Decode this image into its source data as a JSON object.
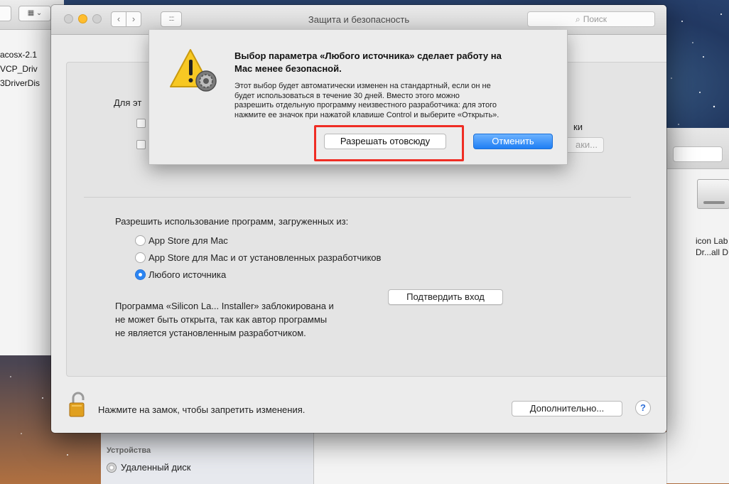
{
  "window": {
    "title": "Защита и безопасность",
    "search_placeholder": "Поиск",
    "grid_glyph": "::::",
    "back_glyph": "‹",
    "forward_glyph": "›"
  },
  "background_finder": {
    "view_button_glyph": "▦ ⌄",
    "files": [
      "acosx-2.1",
      "VCP_Driv",
      "3DriverDis"
    ],
    "right_labels": [
      "icon Lab",
      "Dr...all D"
    ],
    "sidebar_heading": "Устройства",
    "sidebar_item": "Удаленный диск"
  },
  "panel": {
    "partial_label": "Для эт",
    "partial_right_text": "ки",
    "partial_right_button": "аки...",
    "allow_heading": "Разрешить использование программ, загруженных из:",
    "radio_options": [
      {
        "label": "App Store для Mac",
        "selected": false
      },
      {
        "label": "App Store для Mac и от установленных разработчиков",
        "selected": false
      },
      {
        "label": "Любого источника",
        "selected": true
      }
    ],
    "blocked_lines": [
      "Программа «Silicon La... Installer» заблокирована и",
      "не может быть открыта, так как автор программы",
      "не является установленным разработчиком."
    ],
    "confirm_button": "Подтвердить вход"
  },
  "footer": {
    "lock_text": "Нажмите на замок, чтобы запретить изменения.",
    "advanced_button": "Дополнительно...",
    "help_button": "?"
  },
  "alert": {
    "title_lines": [
      "Выбор параметра «Любого источника» сделает работу на",
      "Mac менее безопасной."
    ],
    "body_lines": [
      "Этот выбор будет автоматически изменен на стандартный, если он не",
      "будет использоваться в течение 30 дней. Вместо этого можно",
      "разрешить отдельную программу неизвестного разработчика: для этого",
      "нажмите ее значок при нажатой клавише Control и выберите «Открыть»."
    ],
    "allow_button": "Разрешать отовсюду",
    "cancel_button": "Отменить"
  },
  "colors": {
    "accent": "#1f7ef4",
    "highlight_box": "#ef2d24",
    "warning_yellow": "#f7c823"
  },
  "icons": [
    "close-icon",
    "minimize-icon",
    "zoom-icon",
    "back-icon",
    "forward-icon",
    "show-all-icon",
    "search-icon",
    "warning-icon",
    "lock-icon",
    "disk-icon"
  ]
}
